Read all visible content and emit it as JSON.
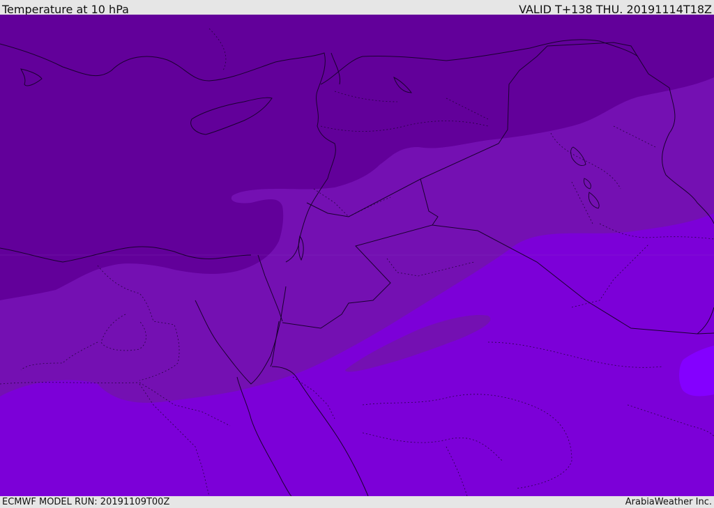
{
  "header": {
    "title": "Temperature at 10 hPa",
    "valid": "VALID T+138 THU. 20191114T18Z"
  },
  "footer": {
    "model_run": "ECMWF MODEL RUN: 20191109T00Z",
    "credit": "ArabiaWeather Inc."
  },
  "map": {
    "colors": {
      "coldest": "#62009a",
      "cold": "#7410b2",
      "mild": "#7c00d8",
      "warm": "#8400ff",
      "coastline": "#1a0030",
      "border": "#1a0030"
    },
    "contour_levels": [
      "coldest",
      "cold",
      "mild",
      "warm"
    ]
  }
}
